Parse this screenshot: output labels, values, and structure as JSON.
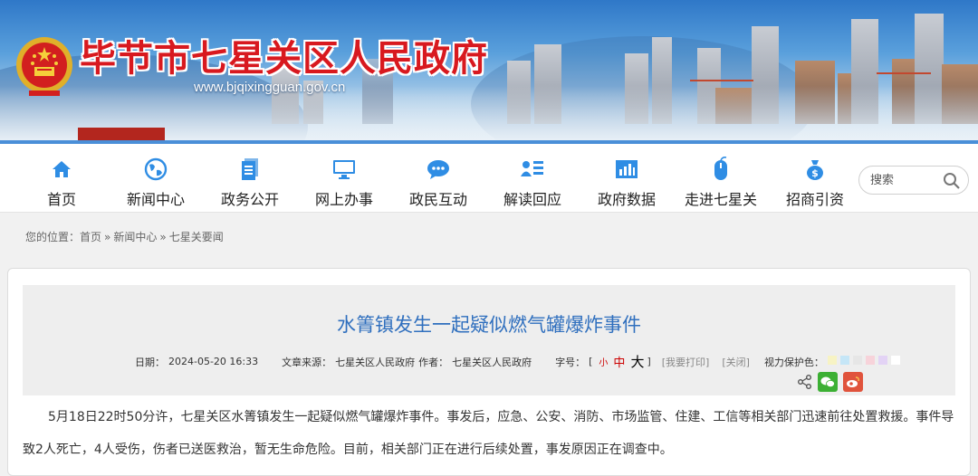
{
  "header": {
    "site_title": "毕节市七星关区人民政府",
    "site_url": "www.bjqixingguan.gov.cn"
  },
  "nav": {
    "items": [
      {
        "label": "首页",
        "icon": "home-icon"
      },
      {
        "label": "新闻中心",
        "icon": "globe-icon"
      },
      {
        "label": "政务公开",
        "icon": "document-icon"
      },
      {
        "label": "网上办事",
        "icon": "monitor-icon"
      },
      {
        "label": "政民互动",
        "icon": "chat-icon"
      },
      {
        "label": "解读回应",
        "icon": "user-list-icon"
      },
      {
        "label": "政府数据",
        "icon": "bar-chart-icon"
      },
      {
        "label": "走进七星关",
        "icon": "mouse-icon"
      },
      {
        "label": "招商引资",
        "icon": "money-bag-icon"
      }
    ],
    "search_placeholder": "搜索",
    "accent_color": "#2f8de4"
  },
  "breadcrumb": {
    "prefix": "您的位置：",
    "items": [
      "首页",
      "新闻中心",
      "七星关要闻"
    ],
    "separator": "»"
  },
  "article": {
    "title": "水箐镇发生一起疑似燃气罐爆炸事件",
    "date_label": "日期：",
    "date": "2024-05-20 16:33",
    "source_label": "文章来源：",
    "source": "七星关区人民政府",
    "author_label": "作者：",
    "author": "七星关区人民政府",
    "font_size_label": "字号：",
    "font_small": "小",
    "font_medium": "中",
    "font_large": "大",
    "print_label": "[我要打印]",
    "close_label": "[关闭]",
    "eye_protect_label": "视力保护色：",
    "eye_colors": [
      "#f7f3c4",
      "#c5e6f7",
      "#e6e6e6",
      "#f7d3da",
      "#e3d3f5",
      "#ffffff"
    ],
    "body": "5月18日22时50分许，七星关区水箐镇发生一起疑似燃气罐爆炸事件。事发后，应急、公安、消防、市场监管、住建、工信等相关部门迅速前往处置救援。事件导致2人死亡，4人受伤，伤者已送医救治，暂无生命危险。目前，相关部门正在进行后续处置，事发原因正在调查中。"
  }
}
